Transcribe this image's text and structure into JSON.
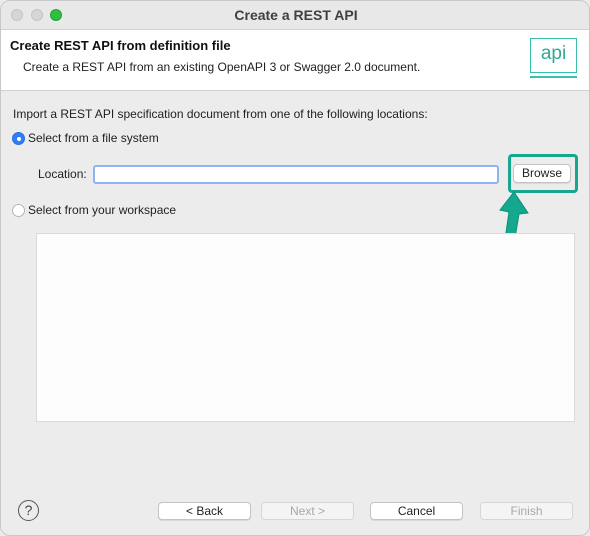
{
  "window": {
    "title": "Create a REST API"
  },
  "header": {
    "title": "Create REST API from definition file",
    "description": "Create a REST API from an existing OpenAPI 3 or Swagger 2.0 document.",
    "logo_text": "api"
  },
  "main": {
    "instructions": "Import a REST API specification document from one of the following locations:",
    "file_system_option": {
      "label": "Select from a file system",
      "selected": true
    },
    "location": {
      "label": "Location:",
      "value": ""
    },
    "browse_label": "Browse",
    "workspace_option": {
      "label": "Select from your workspace",
      "selected": false
    }
  },
  "footer": {
    "help_glyph": "?",
    "back_label": "< Back",
    "next_label": "Next >",
    "cancel_label": "Cancel",
    "finish_label": "Finish"
  },
  "colors": {
    "accent": "#14a88e",
    "radio_selected": "#2f7df6",
    "input_focus": "#8db4ef"
  },
  "icons": {
    "annotation": "arrow-icon",
    "help": "help-icon"
  }
}
